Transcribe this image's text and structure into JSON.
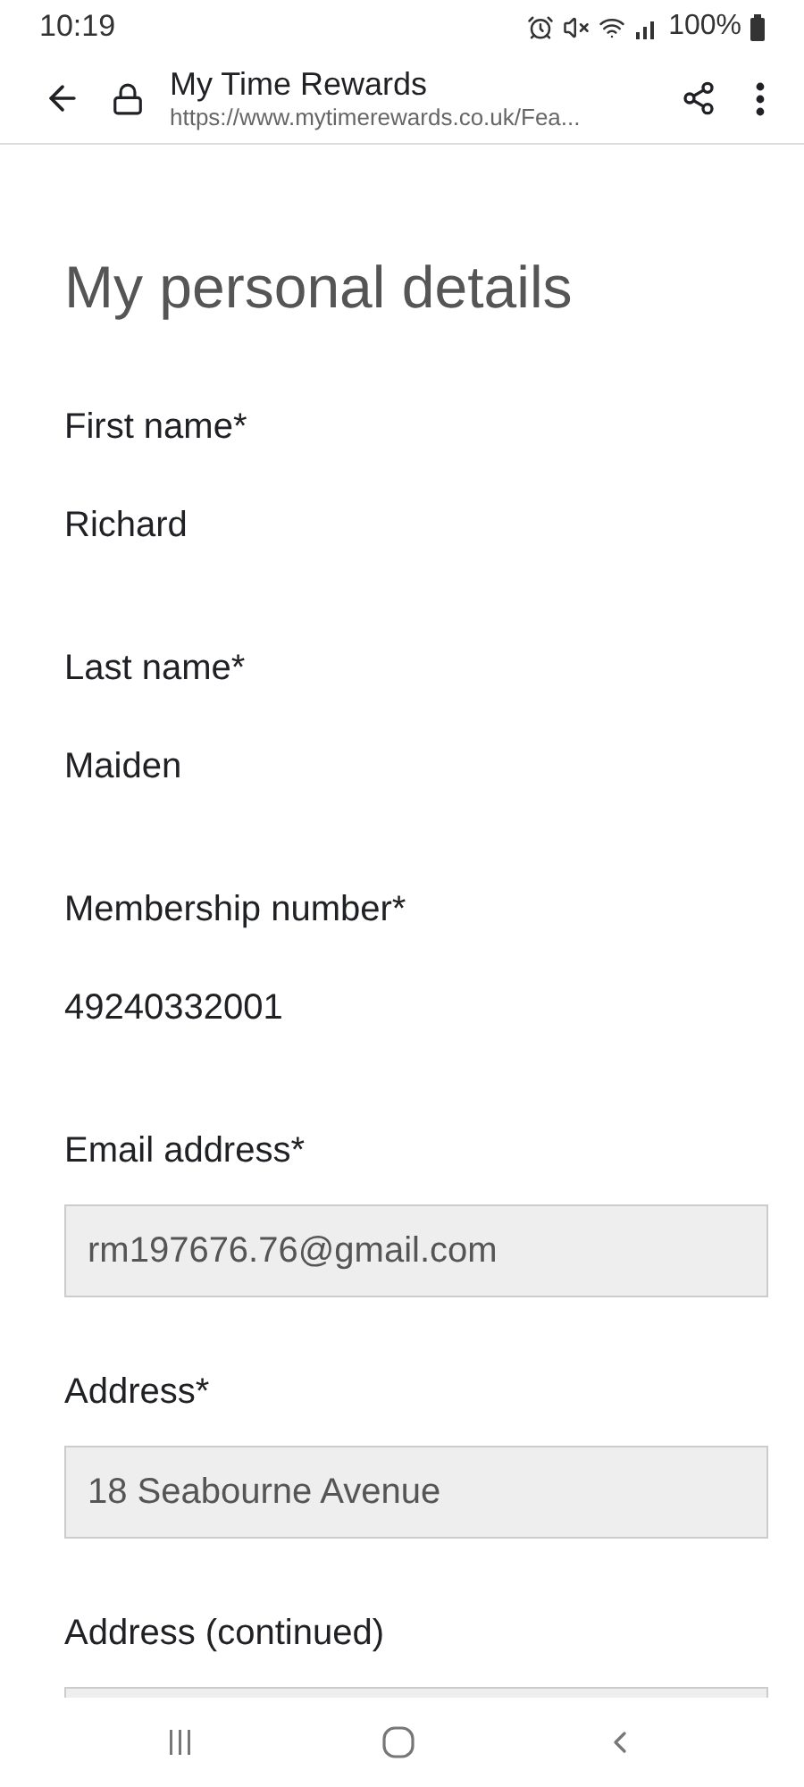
{
  "status_bar": {
    "time": "10:19",
    "battery": "100%"
  },
  "browser": {
    "title": "My Time Rewards",
    "url": "https://www.mytimerewards.co.uk/Fea..."
  },
  "heading": "My personal details",
  "fields": [
    {
      "kind": "text",
      "label": "First name*",
      "value": "Richard"
    },
    {
      "kind": "text",
      "label": "Last name*",
      "value": "Maiden"
    },
    {
      "kind": "text",
      "label": "Membership number*",
      "value": "49240332001"
    },
    {
      "kind": "input",
      "label": "Email address*",
      "value": "rm197676.76@gmail.com"
    },
    {
      "kind": "input",
      "label": "Address*",
      "value": "18 Seabourne Avenue"
    },
    {
      "kind": "input",
      "label": "Address (continued)"
    }
  ]
}
